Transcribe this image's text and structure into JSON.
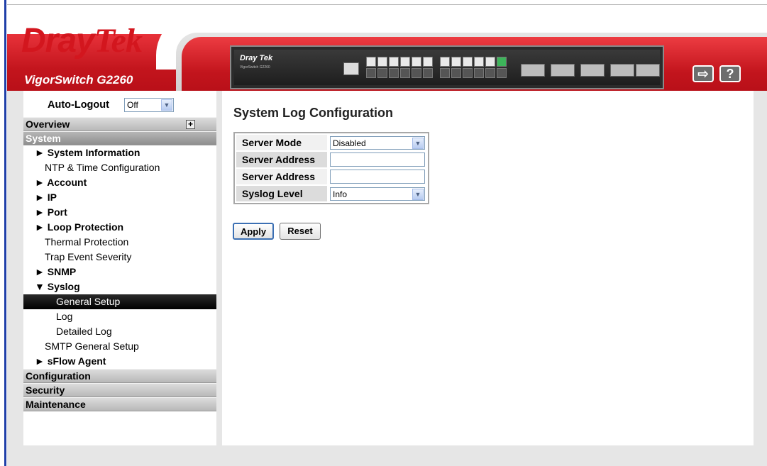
{
  "brand": {
    "logo_dray": "Dray",
    "logo_tek": "Tek",
    "model": "VigorSwitch G2260",
    "device_brand": "Dray Tek",
    "device_subtitle": "VigorSwitch G2260",
    "logo_color": "#d3161e",
    "accent_red": "#c3151d"
  },
  "header_buttons": [
    {
      "icon": "logout-icon",
      "glyph": "⇨"
    },
    {
      "icon": "help-icon",
      "glyph": "?"
    }
  ],
  "auto_logout": {
    "label": "Auto-Logout",
    "value": "Off"
  },
  "sidebar": {
    "overview": "Overview",
    "system": "System",
    "items": [
      {
        "label": "► System Information",
        "style": "bold"
      },
      {
        "label": "NTP & Time Configuration",
        "style": "plain"
      },
      {
        "label": "► Account",
        "style": "bold"
      },
      {
        "label": "► IP",
        "style": "bold"
      },
      {
        "label": "► Port",
        "style": "bold"
      },
      {
        "label": "► Loop Protection",
        "style": "bold"
      },
      {
        "label": "Thermal Protection",
        "style": "plain"
      },
      {
        "label": "Trap Event Severity",
        "style": "plain"
      },
      {
        "label": "► SNMP",
        "style": "bold"
      },
      {
        "label": "▼ Syslog",
        "style": "bold"
      },
      {
        "label": "General Setup",
        "style": "sub",
        "selected": true
      },
      {
        "label": "Log",
        "style": "sub"
      },
      {
        "label": "Detailed Log",
        "style": "sub"
      },
      {
        "label": "SMTP General Setup",
        "style": "plain"
      },
      {
        "label": "► sFlow Agent",
        "style": "bold"
      }
    ],
    "bottom_sections": [
      "Configuration",
      "Security",
      "Maintenance"
    ]
  },
  "main": {
    "title": "System Log Configuration",
    "rows": [
      {
        "label": "Server Mode",
        "type": "select",
        "value": "Disabled"
      },
      {
        "label": "Server Address",
        "type": "text",
        "value": ""
      },
      {
        "label": "Server Address",
        "type": "text",
        "value": ""
      },
      {
        "label": "Syslog Level",
        "type": "select",
        "value": "Info"
      }
    ],
    "apply_label": "Apply",
    "reset_label": "Reset"
  }
}
